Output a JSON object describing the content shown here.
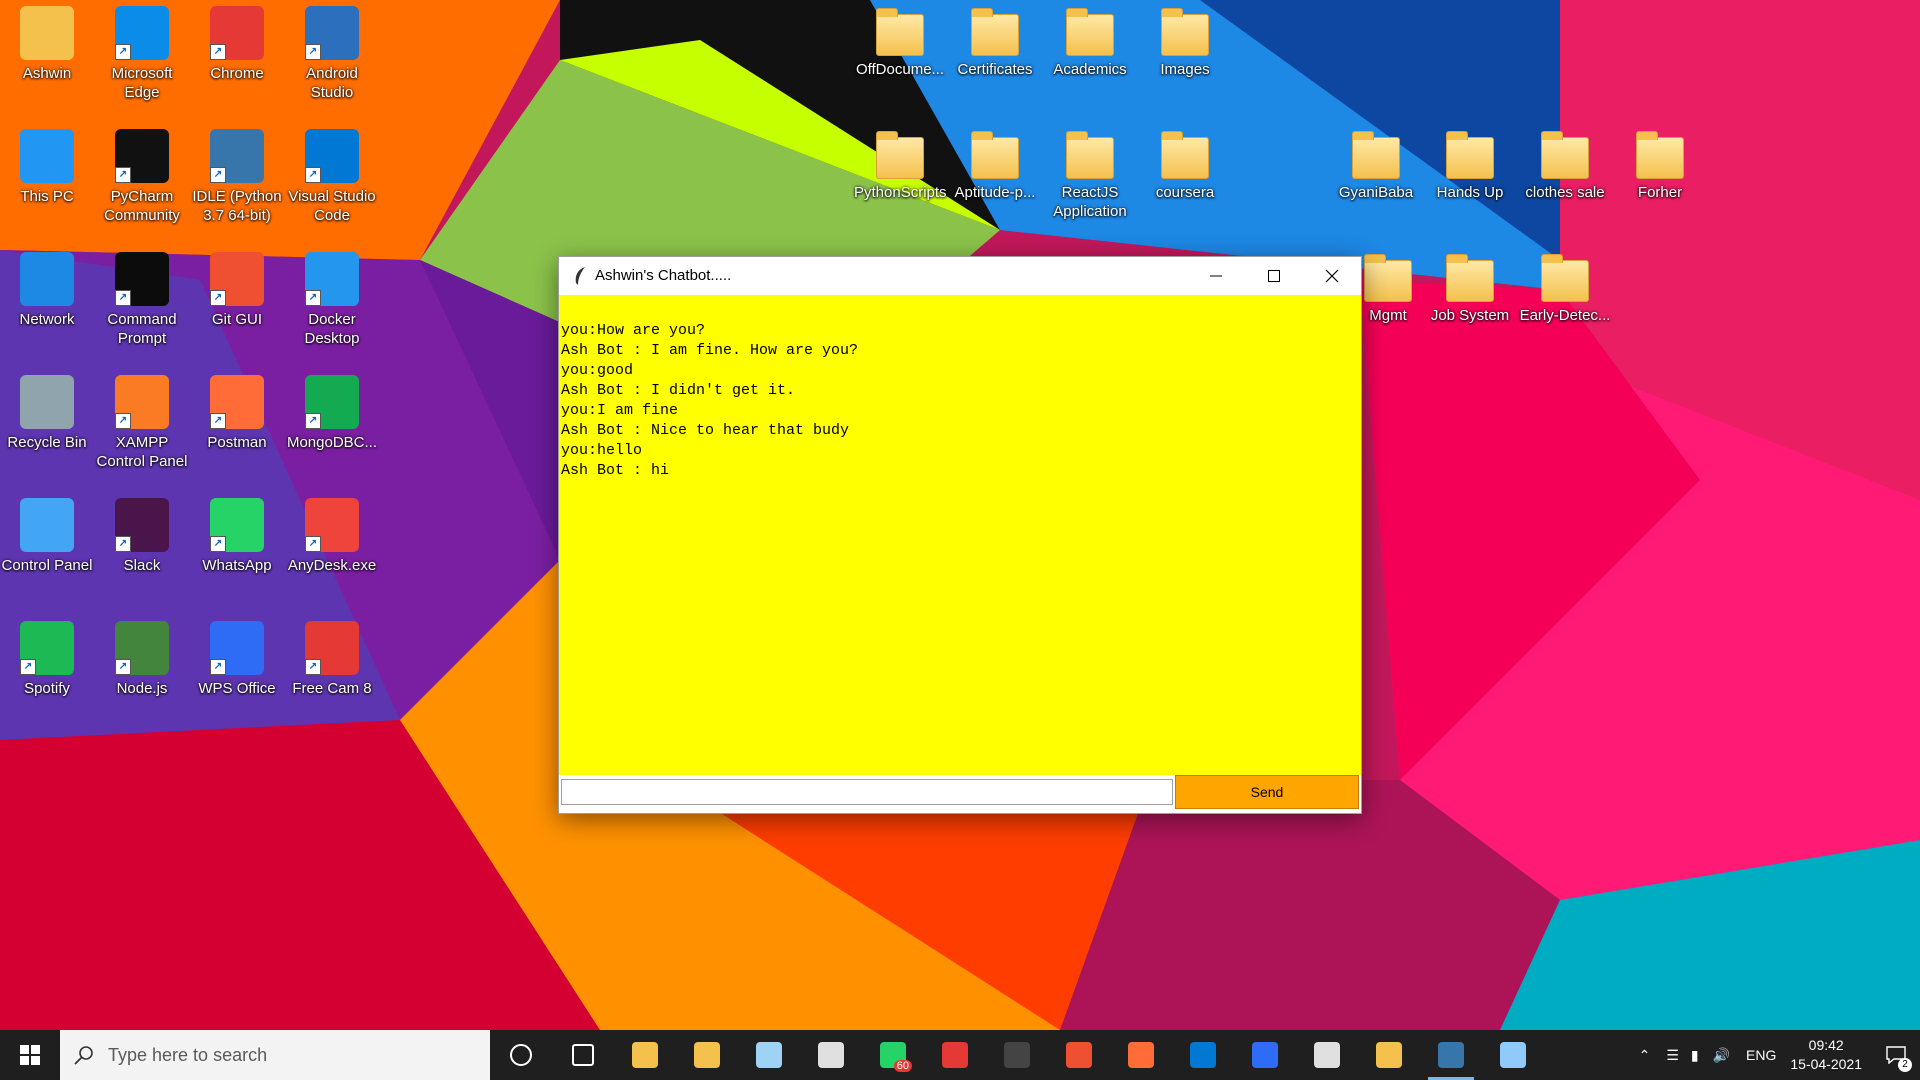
{
  "desktop": {
    "icons_left": [
      {
        "label": "Ashwin",
        "icon": "user-folder-icon",
        "color": "#f4c14c"
      },
      {
        "label": "Microsoft Edge",
        "icon": "edge-icon",
        "color": "#0c8ce9"
      },
      {
        "label": "Chrome",
        "icon": "chrome-icon",
        "color": "#e53935"
      },
      {
        "label": "Android Studio",
        "icon": "android-studio-icon",
        "color": "#2b6fbd"
      },
      {
        "label": "This PC",
        "icon": "computer-icon",
        "color": "#2196f3"
      },
      {
        "label": "PyCharm Community",
        "icon": "pycharm-icon",
        "color": "#111111"
      },
      {
        "label": "IDLE (Python 3.7 64-bit)",
        "icon": "python-idle-icon",
        "color": "#3776ab"
      },
      {
        "label": "Visual Studio Code",
        "icon": "vscode-icon",
        "color": "#0078d4"
      },
      {
        "label": "Network",
        "icon": "network-icon",
        "color": "#1e88e5"
      },
      {
        "label": "Command Prompt",
        "icon": "cmd-icon",
        "color": "#0c0c0c"
      },
      {
        "label": "Git GUI",
        "icon": "git-icon",
        "color": "#f05032"
      },
      {
        "label": "Docker Desktop",
        "icon": "docker-icon",
        "color": "#2496ed"
      },
      {
        "label": "Recycle Bin",
        "icon": "recycle-bin-icon",
        "color": "#90a4ae"
      },
      {
        "label": "XAMPP Control Panel",
        "icon": "xampp-icon",
        "color": "#fb7a24"
      },
      {
        "label": "Postman",
        "icon": "postman-icon",
        "color": "#ff6c37"
      },
      {
        "label": "MongoDBC...",
        "icon": "mongodb-icon",
        "color": "#13aa52"
      },
      {
        "label": "Control Panel",
        "icon": "control-panel-icon",
        "color": "#42a5f5"
      },
      {
        "label": "Slack",
        "icon": "slack-icon",
        "color": "#4a154b"
      },
      {
        "label": "WhatsApp",
        "icon": "whatsapp-icon",
        "color": "#25d366"
      },
      {
        "label": "AnyDesk.exe",
        "icon": "anydesk-icon",
        "color": "#ef443b"
      },
      {
        "label": "Spotify",
        "icon": "spotify-icon",
        "color": "#1db954"
      },
      {
        "label": "Node.js",
        "icon": "nodejs-icon",
        "color": "#43853d"
      },
      {
        "label": "WPS Office",
        "icon": "wps-office-icon",
        "color": "#2f6cf6"
      },
      {
        "label": "Free Cam 8",
        "icon": "free-cam-icon",
        "color": "#e53935"
      }
    ],
    "icons_right": [
      {
        "label": "OffDocume..."
      },
      {
        "label": "Certificates"
      },
      {
        "label": "Academics"
      },
      {
        "label": "Images"
      },
      {
        "label": "PythonScripts"
      },
      {
        "label": "Aptitude-p..."
      },
      {
        "label": "ReactJS Application"
      },
      {
        "label": "coursera"
      },
      {
        "label": "GyaniBaba"
      },
      {
        "label": "Hands Up"
      },
      {
        "label": "clothes sale"
      },
      {
        "label": "Forher"
      },
      {
        "label": "Mgmt"
      },
      {
        "label": "Job System"
      },
      {
        "label": "Early-Detec..."
      }
    ]
  },
  "window": {
    "title": "Ashwin's Chatbot.....",
    "log": "you:How are you?\nAsh Bot : I am fine. How are you?\nyou:good\nAsh Bot : I didn't get it.\nyou:I am fine\nAsh Bot : Nice to hear that budy\nyou:hello\nAsh Bot : hi",
    "entry_value": "",
    "send_label": "Send",
    "colors": {
      "log_bg": "#ffff00",
      "send_bg": "#ffa500"
    }
  },
  "taskbar": {
    "search_placeholder": "Type here to search",
    "whatsapp_badge": "60",
    "tray": {
      "language": "ENG",
      "time": "09:42",
      "date": "15-04-2021",
      "notifications": "2"
    },
    "apps": [
      "cortana-icon",
      "task-view-icon",
      "store-icon",
      "file-explorer-icon",
      "notepad-icon",
      "paint-icon",
      "whatsapp-icon",
      "chrome-icon",
      "terminal-icon",
      "git-icon",
      "postman-icon",
      "vscode-icon",
      "wps-icon",
      "photos-icon",
      "folder-icon",
      "python-icon",
      "notepad-doc-icon"
    ]
  }
}
